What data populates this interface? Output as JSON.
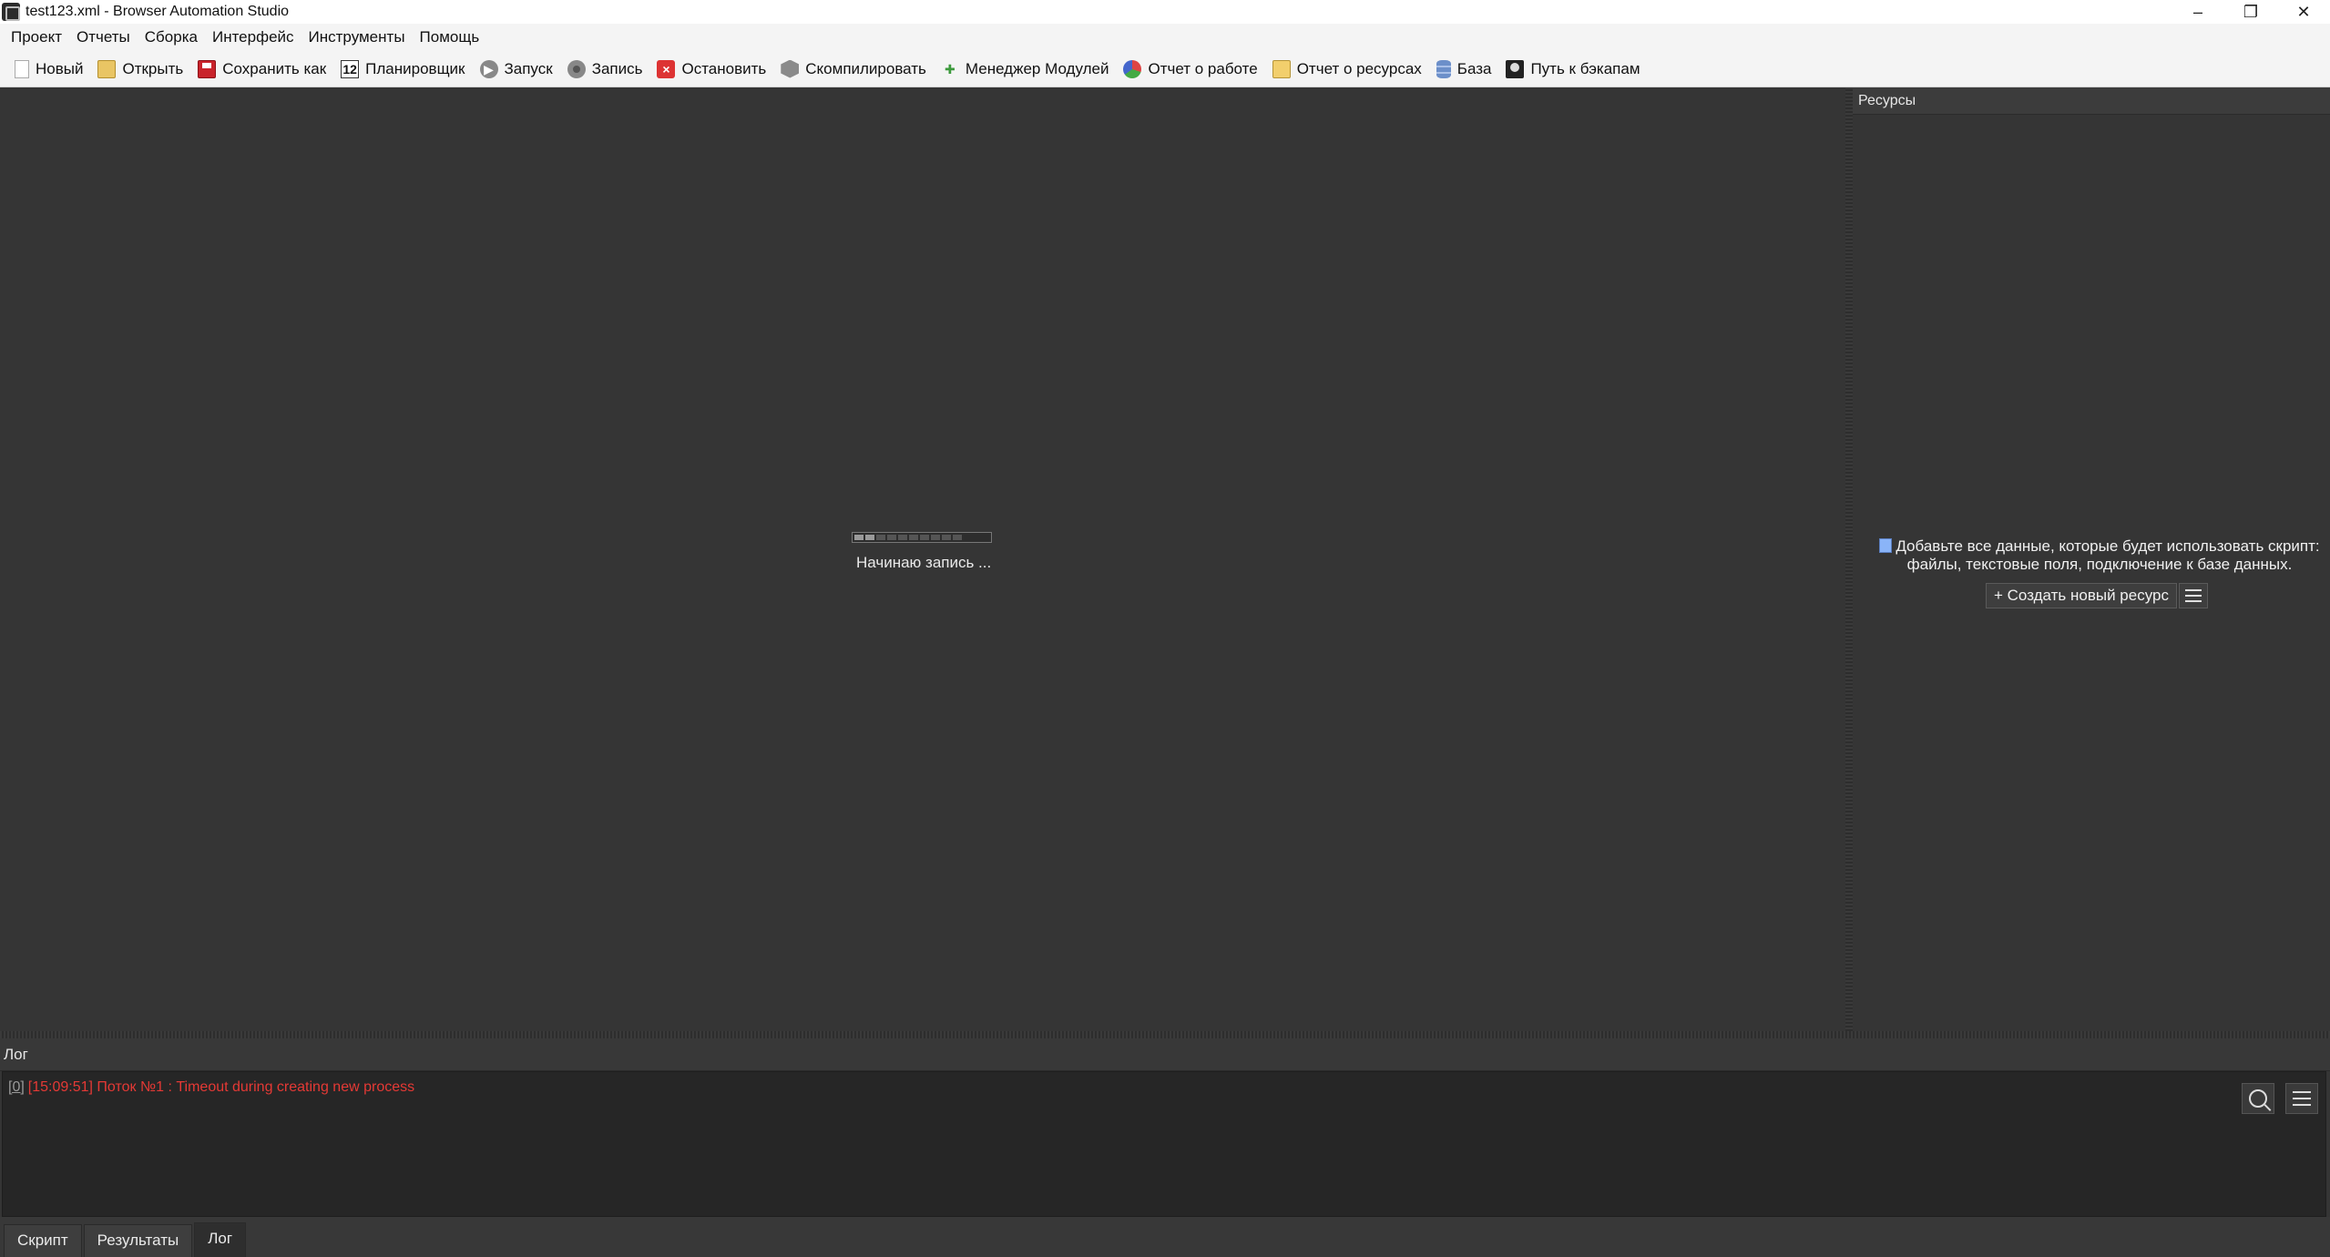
{
  "window": {
    "title": "test123.xml - Browser Automation Studio",
    "minimize": "–",
    "restore": "❐",
    "close": "✕"
  },
  "menu": [
    "Проект",
    "Отчеты",
    "Сборка",
    "Интерфейс",
    "Инструменты",
    "Помощь"
  ],
  "toolbar": {
    "new": "Новый",
    "open": "Открыть",
    "save_as": "Сохранить как",
    "scheduler": "Планировщик",
    "scheduler_icon_text": "12",
    "run": "Запуск",
    "record": "Запись",
    "stop": "Остановить",
    "compile": "Скомпилировать",
    "module_manager": "Менеджер Модулей",
    "work_report": "Отчет о работе",
    "resource_report": "Отчет о ресурсах",
    "database": "База",
    "backup_path": "Путь к бэкапам"
  },
  "main": {
    "status": "Начинаю запись ..."
  },
  "resources": {
    "header": "Ресурсы",
    "info_line1": "Добавьте все данные, которые будет использовать скрипт:",
    "info_line2": "файлы, текстовые поля, подключение к базе данных.",
    "create_button": "+ Создать новый ресурс"
  },
  "log": {
    "header": "Лог",
    "entries": [
      {
        "index": "[0]",
        "text": "[15:09:51] Поток №1 : Timeout during creating new process",
        "color": "#e53935"
      }
    ]
  },
  "tabs": [
    {
      "label": "Скрипт",
      "active": false
    },
    {
      "label": "Результаты",
      "active": false
    },
    {
      "label": "Лог",
      "active": true
    }
  ]
}
